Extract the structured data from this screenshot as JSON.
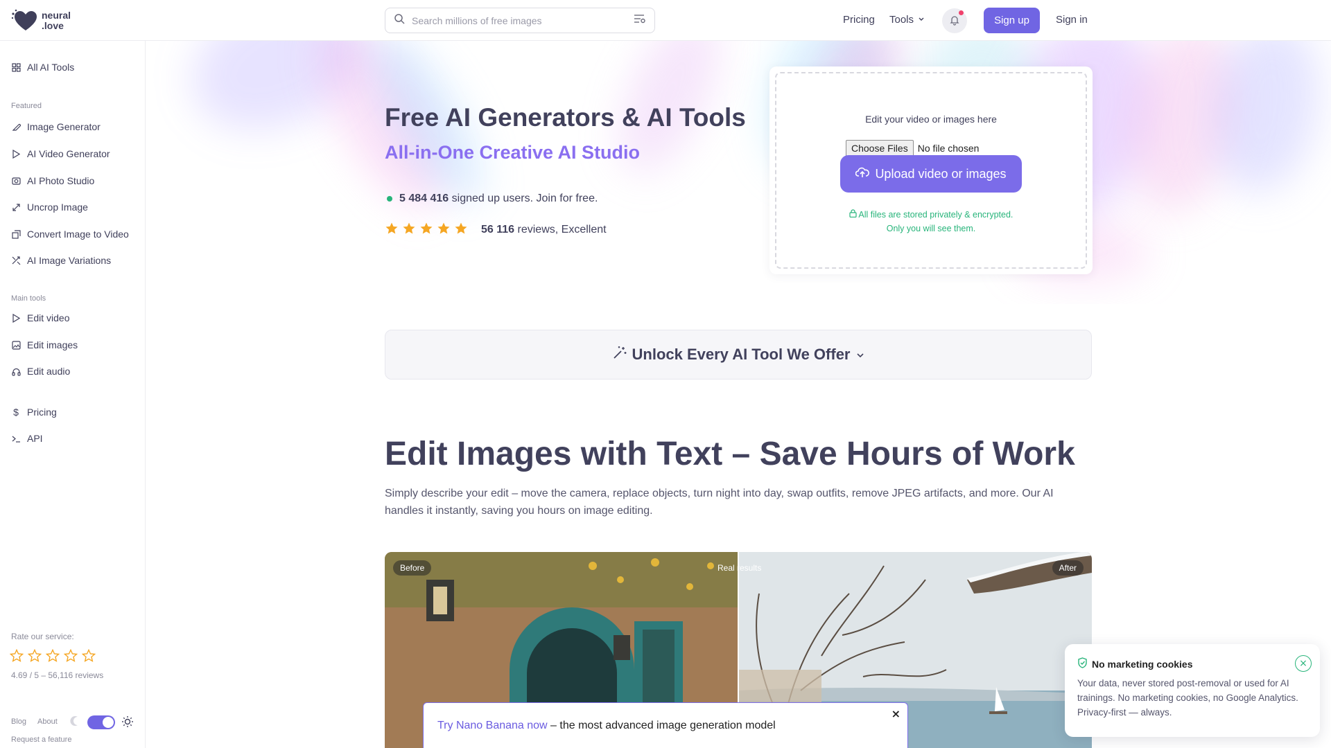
{
  "brand": {
    "name_line1": "neural",
    "name_line2": ".love"
  },
  "header": {
    "search_placeholder": "Search millions of free images",
    "pricing": "Pricing",
    "tools": "Tools",
    "signup": "Sign up",
    "signin": "Sign in"
  },
  "sidebar": {
    "all_tools": "All AI Tools",
    "featured_label": "Featured",
    "featured": [
      {
        "label": "Image Generator",
        "icon": "brush-icon"
      },
      {
        "label": "AI Video Generator",
        "icon": "play-icon"
      },
      {
        "label": "AI Photo Studio",
        "icon": "camera-icon"
      },
      {
        "label": "Uncrop Image",
        "icon": "expand-icon"
      },
      {
        "label": "Convert Image to Video",
        "icon": "convert-icon"
      },
      {
        "label": "AI Image Variations",
        "icon": "shuffle-icon"
      }
    ],
    "main_label": "Main tools",
    "main": [
      {
        "label": "Edit video",
        "icon": "play-icon"
      },
      {
        "label": "Edit images",
        "icon": "image-icon"
      },
      {
        "label": "Edit audio",
        "icon": "headphones-icon"
      }
    ],
    "pricing": "Pricing",
    "api": "API",
    "rate_label": "Rate our service:",
    "rate_value": "4.69 / 5 – 56,116 reviews",
    "blog": "Blog",
    "about": "About",
    "request": "Request a feature"
  },
  "hero": {
    "title": "Free AI Generators & AI Tools",
    "subtitle": "All-in-One Creative AI Studio",
    "users_count": "5 484 416",
    "users_text": "signed up users. Join for free.",
    "reviews_count": "56 116",
    "reviews_text": "reviews, Excellent",
    "rating_stars": 5
  },
  "upload": {
    "hint": "Edit your video or images here",
    "choose": "Choose Files",
    "no_file": "No file chosen",
    "button": "Upload video or images",
    "note_line1": "All files are stored privately & encrypted.",
    "note_line2": "Only you will see them."
  },
  "unlock": {
    "label": "Unlock Every AI Tool We Offer"
  },
  "section": {
    "title": "Edit Images with Text – Save Hours of Work",
    "description": "Simply describe your edit – move the camera, replace objects, turn night into day, swap outfits, remove JPEG artifacts, and more. Our AI handles it instantly, saving you hours on image editing."
  },
  "compare": {
    "before": "Before",
    "real": "Real results",
    "after": "After"
  },
  "nano": {
    "link": "Try Nano Banana now",
    "text": " – the most advanced image generation model",
    "close": "×"
  },
  "cookie": {
    "title": "No marketing cookies",
    "body": "Your data, never stored post-removal or used for AI trainings. No marketing cookies, no Google Analytics. Privacy-first — always.",
    "close": "×"
  },
  "colors": {
    "accent": "#7065e3",
    "accent_text": "#8a6ff0",
    "success": "#27b47a",
    "star": "#f5a623"
  }
}
